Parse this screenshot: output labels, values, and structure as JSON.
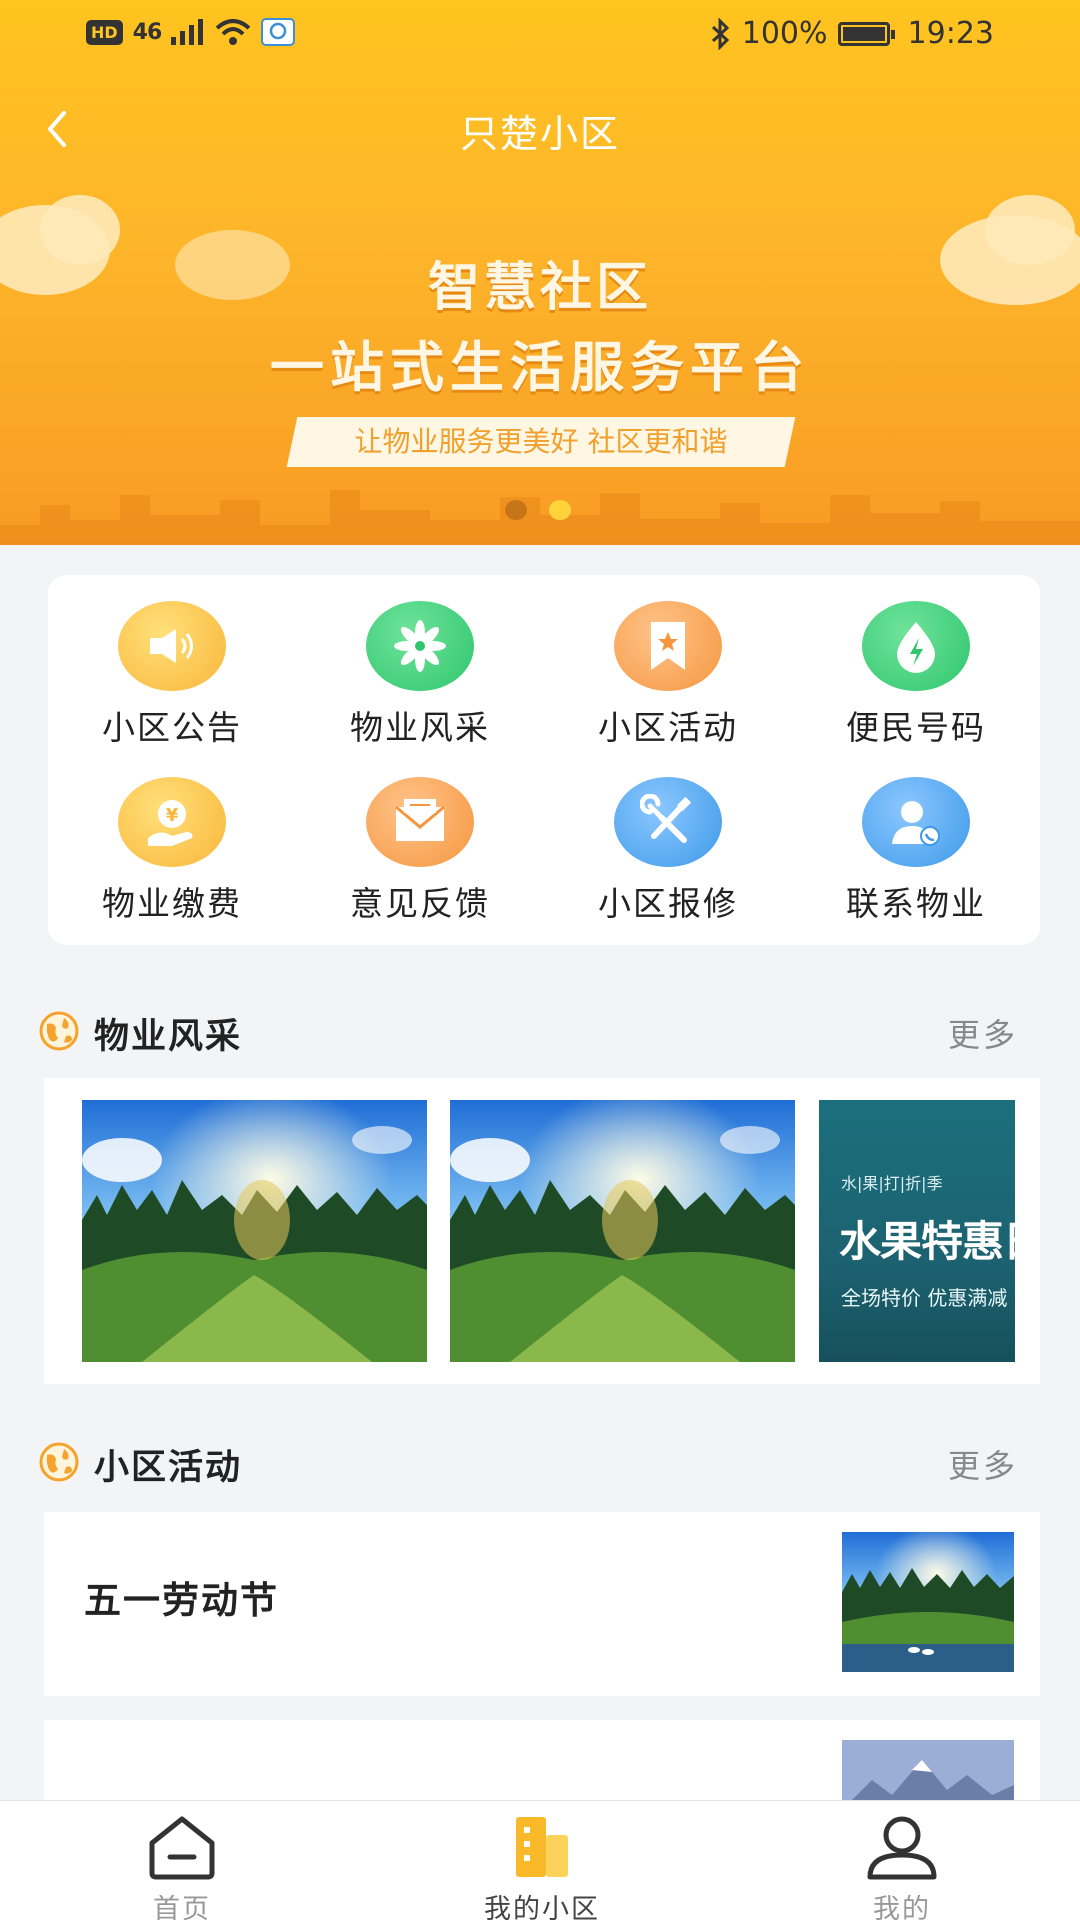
{
  "status_bar": {
    "hd": "HD",
    "network": "46",
    "battery": "100%",
    "time": "19:23"
  },
  "nav": {
    "title": "只楚小区"
  },
  "banner": {
    "headline": "智慧社区",
    "subheadline": "一站式生活服务平台",
    "slogan": "让物业服务更美好  社区更和谐",
    "active_dot": 1
  },
  "quick_actions": [
    {
      "label": "小区公告",
      "icon": "megaphone-icon",
      "color": "#f9b63a"
    },
    {
      "label": "物业风采",
      "icon": "flower-icon",
      "color": "#2fc66e"
    },
    {
      "label": "小区活动",
      "icon": "bookmark-star-icon",
      "color": "#f5963f"
    },
    {
      "label": "便民号码",
      "icon": "lightning-drop-icon",
      "color": "#2fc66e"
    },
    {
      "label": "物业缴费",
      "icon": "yen-hand-icon",
      "color": "#f9b63a"
    },
    {
      "label": "意见反馈",
      "icon": "envelope-icon",
      "color": "#f5963f"
    },
    {
      "label": "小区报修",
      "icon": "tools-icon",
      "color": "#3d9ae8"
    },
    {
      "label": "联系物业",
      "icon": "contact-person-icon",
      "color": "#3d9ae8"
    }
  ],
  "sections": {
    "style": {
      "title": "物业风采",
      "more": "更多"
    },
    "activities": {
      "title": "小区活动",
      "more": "更多"
    }
  },
  "gallery": {
    "promo": {
      "tag": "水|果|打|折|季",
      "title": "水果特惠日",
      "subtitle": "全场特价 优惠满减"
    }
  },
  "activities": [
    {
      "title": "五一劳动节"
    }
  ],
  "tabs": [
    {
      "label": "首页",
      "icon": "home-icon"
    },
    {
      "label": "我的小区",
      "icon": "buildings-icon"
    },
    {
      "label": "我的",
      "icon": "person-icon"
    }
  ],
  "colors": {
    "brand": "#fdb52a",
    "tab_active": "#f9b928"
  }
}
